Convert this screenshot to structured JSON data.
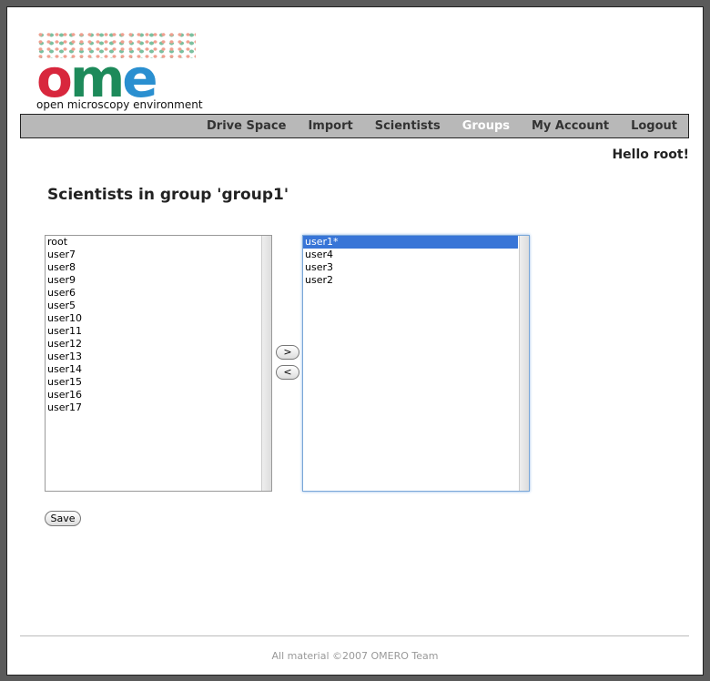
{
  "logo": {
    "word": [
      "o",
      "m",
      "e"
    ],
    "subtitle": "open microscopy environment"
  },
  "nav": {
    "items": [
      {
        "label": "Drive Space"
      },
      {
        "label": "Import"
      },
      {
        "label": "Scientists"
      },
      {
        "label": "Groups",
        "active": true
      },
      {
        "label": "My Account"
      },
      {
        "label": "Logout"
      }
    ]
  },
  "greeting": "Hello root!",
  "page_title": "Scientists in group 'group1'",
  "available_users": [
    "root",
    "user7",
    "user8",
    "user9",
    "user6",
    "user5",
    "user10",
    "user11",
    "user12",
    "user13",
    "user14",
    "user15",
    "user16",
    "user17"
  ],
  "group_members": [
    "user1*",
    "user4",
    "user3",
    "user2"
  ],
  "selected_member": "user1*",
  "buttons": {
    "add": ">",
    "remove": "<",
    "save": "Save"
  },
  "footer": "All material ©2007 OMERO Team",
  "colors": {
    "nav_bg": "#b8b8b8",
    "selection": "#3875d7"
  }
}
